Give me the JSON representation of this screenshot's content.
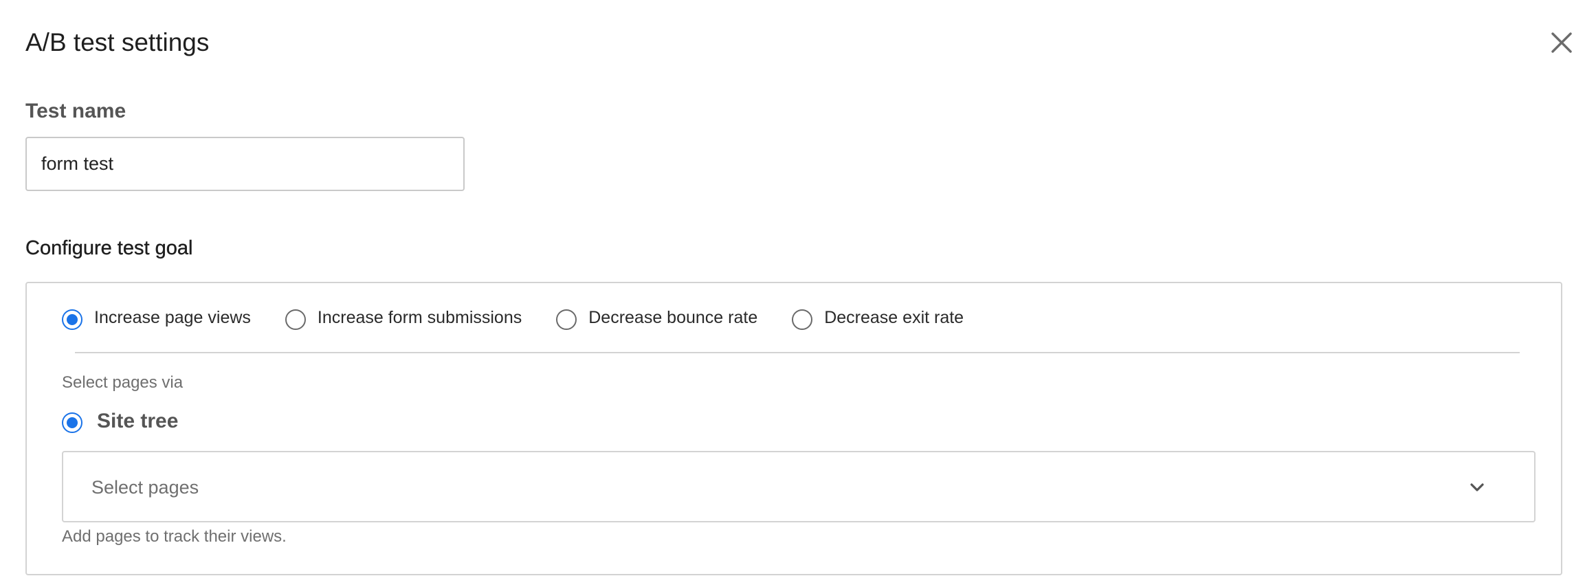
{
  "dialog": {
    "title": "A/B test settings",
    "close_icon": "close-icon"
  },
  "test_name": {
    "label": "Test name",
    "value": "form test"
  },
  "goal": {
    "section_title": "Configure test goal",
    "options": [
      {
        "label": "Increase page views",
        "checked": true
      },
      {
        "label": "Increase form submissions",
        "checked": false
      },
      {
        "label": "Decrease bounce rate",
        "checked": false
      },
      {
        "label": "Decrease exit rate",
        "checked": false
      }
    ],
    "select_via_label": "Select pages via",
    "site_tree": {
      "label": "Site tree",
      "checked": true
    },
    "pages_select": {
      "placeholder": "Select pages",
      "icon": "chevron-down-icon"
    },
    "help_text": "Add pages to track their views."
  },
  "colors": {
    "accent": "#1a73e8",
    "border": "#d3d3d3",
    "muted_text": "#6f6f6f"
  }
}
